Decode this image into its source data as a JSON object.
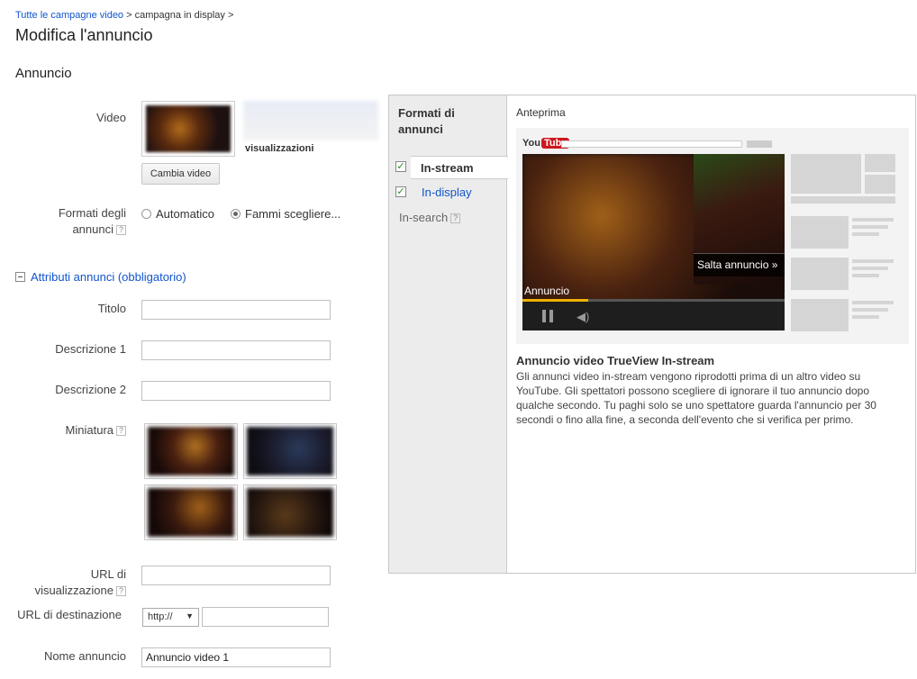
{
  "breadcrumb": {
    "root": "Tutte le campagne video",
    "sep": ">",
    "current": "campagna in display >"
  },
  "page_title": "Modifica l'annuncio",
  "section_title": "Annuncio",
  "video": {
    "label": "Video",
    "views_label": "visualizzazioni",
    "change_button": "Cambia video"
  },
  "formats": {
    "label_line1": "Formati degli",
    "label_line2": "annunci",
    "help": "?",
    "option_auto": "Automatico",
    "option_choose": "Fammi scegliere..."
  },
  "attributes": {
    "header": "Attributi annunci (obbligatorio)"
  },
  "fields": {
    "title_label": "Titolo",
    "desc1_label": "Descrizione 1",
    "desc2_label": "Descrizione 2",
    "thumbnail_label": "Miniatura",
    "display_url_line1": "URL di",
    "display_url_line2": "visualizzazione",
    "dest_url_label": "URL di destinazione",
    "protocol_value": "http://",
    "ad_name_label": "Nome annuncio",
    "ad_name_value": "Annuncio video 1"
  },
  "panel": {
    "formats_title_line1": "Formati di",
    "formats_title_line2": "annunci",
    "tab_instream": "In-stream",
    "tab_indisplay": "In-display",
    "tab_insearch": "In-search",
    "help": "?",
    "preview_label": "Anteprima",
    "yt_logo_you": "You",
    "yt_logo_tube": "Tube",
    "skip_label": "Salta annuncio »",
    "ad_label": "Annuncio",
    "desc_title": "Annuncio video TrueView In-stream",
    "desc_body": "Gli annunci video in-stream vengono riprodotti prima di un altro video su YouTube. Gli spettatori possono scegliere di ignorare il tuo annuncio dopo qualche secondo. Tu paghi solo se uno spettatore guarda l'annuncio per 30 secondi o fino alla fine, a seconda dell'evento che si verifica per primo."
  },
  "progress_fraction": 0.25,
  "colors": {
    "link": "#1155cc",
    "check": "#2a8a2a",
    "youtube_red": "#cc181e",
    "progress": "#f0b000"
  }
}
